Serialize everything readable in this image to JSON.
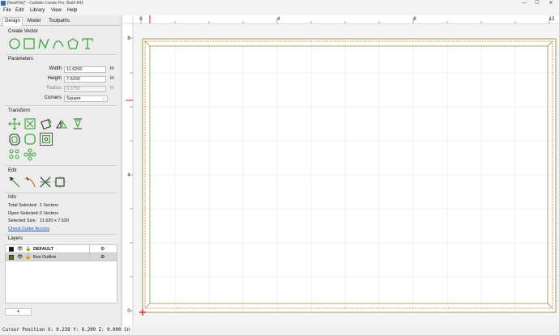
{
  "window": {
    "title": "[NewFile]* - Carbide Create Pro, Build 841",
    "minimize_glyph": "—",
    "maximize_glyph": "☐",
    "close_glyph": "✕"
  },
  "menu": [
    "File",
    "Edit",
    "Library",
    "View",
    "Help"
  ],
  "tabs": [
    "Design",
    "Model",
    "Toolpaths"
  ],
  "create_vector": {
    "title": "Create Vector",
    "tools": [
      "circle-icon",
      "rectangle-icon",
      "polyline-icon",
      "curve-icon",
      "polygon-icon",
      "text-icon"
    ]
  },
  "parameters": {
    "title": "Parameters",
    "width": {
      "label": "Width",
      "value": "11.6200",
      "unit": "in"
    },
    "height": {
      "label": "Height",
      "value": "7.6200",
      "unit": "in"
    },
    "radius": {
      "label": "Radius",
      "value": "0.3750",
      "unit": "in"
    },
    "corners": {
      "label": "Corners",
      "value": "Square"
    }
  },
  "transform": {
    "title": "Transform",
    "tools_row1": [
      "move-icon",
      "scale-icon",
      "rotate-icon",
      "mirror-icon",
      "align-icon"
    ],
    "tools_row2": [
      "offset-icon",
      "round-corners-icon",
      "boolean-icon"
    ],
    "tools_row3": [
      "array-icon",
      "circular-array-icon"
    ]
  },
  "edit": {
    "title": "Edit",
    "tools": [
      "node-edit-icon",
      "trim-icon",
      "cut-icon",
      "group-icon"
    ]
  },
  "info": {
    "title": "Info",
    "total_selected_label": "Total Selected:",
    "total_selected_value": "1 Vectors",
    "open_selected_label": "Open Selected:",
    "open_selected_value": "0 Vectors",
    "selected_size_label": "Selected Size:",
    "selected_size_value": "11.620 x 7.620",
    "check_cutter_link": "Check Cutter Access"
  },
  "layers": {
    "title": "Layers",
    "items": [
      {
        "name": "DEFAULT",
        "color": "#111111",
        "bold": true,
        "gear": "⚙"
      },
      {
        "name": "Box Outline",
        "color": "#6b6b14",
        "bold": false,
        "gear": "⚙"
      }
    ],
    "add_label": "+"
  },
  "rulers": {
    "top_labels": [
      "0",
      "4",
      "8",
      "12"
    ],
    "left_labels": [
      "8",
      "4",
      "0"
    ]
  },
  "status": {
    "cursor_text": "Cursor Position X: 0.239 Y: 6.209 Z: 0.000 in"
  },
  "colors": {
    "accent_green": "#3aa635",
    "outline_orange": "#e8692a",
    "origin_red": "#e02020",
    "stock_border": "#7a8a2a"
  }
}
